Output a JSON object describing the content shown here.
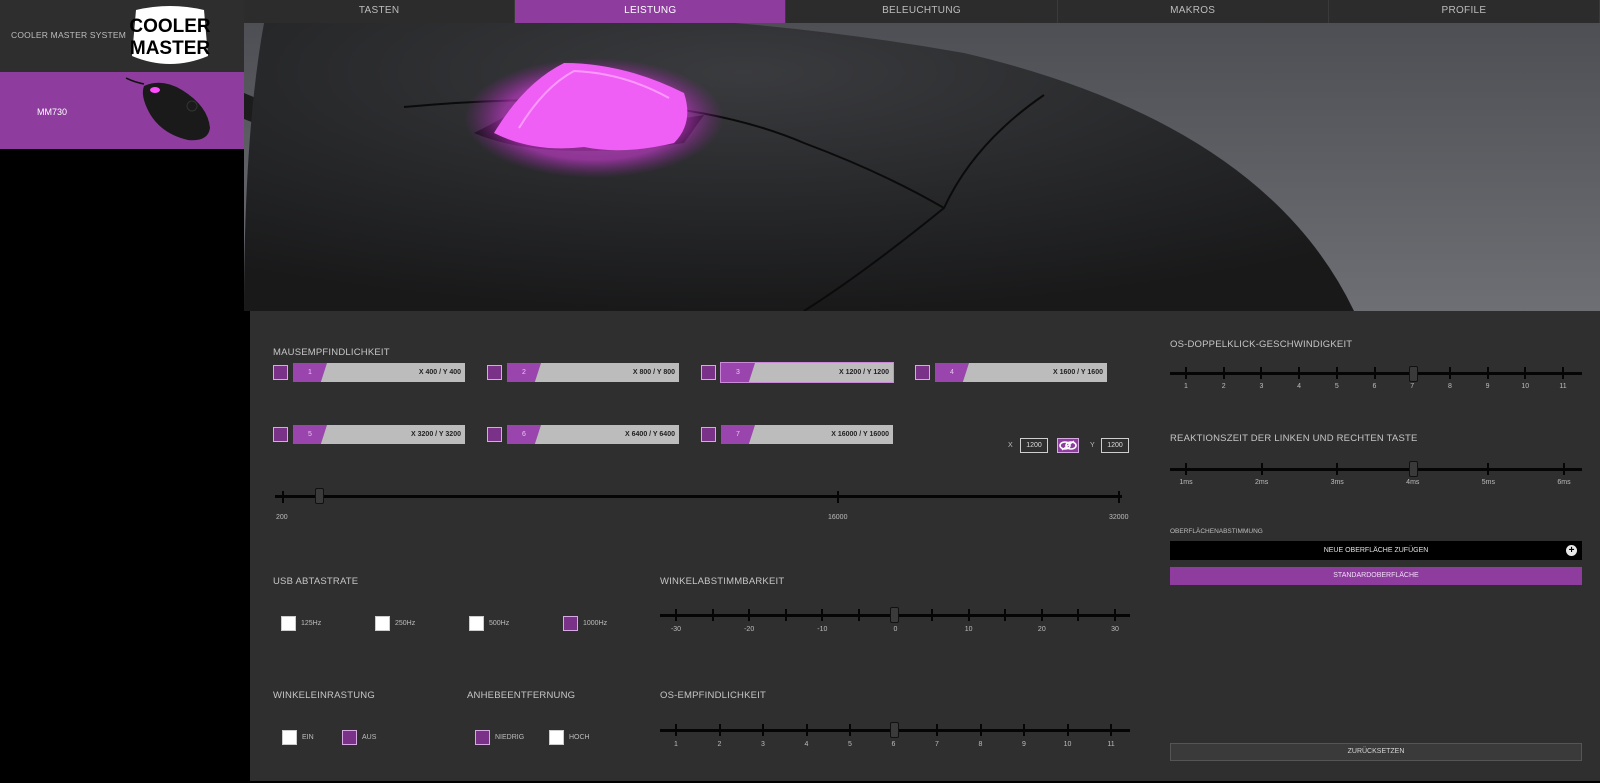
{
  "brand": {
    "system_label": "COOLER MASTER SYSTEM",
    "logo_line1": "COOLER",
    "logo_line2": "MASTER"
  },
  "device": {
    "name": "MM730"
  },
  "tabs": [
    {
      "label": "TASTEN",
      "active": false
    },
    {
      "label": "LEISTUNG",
      "active": true
    },
    {
      "label": "BELEUCHTUNG",
      "active": false
    },
    {
      "label": "MAKROS",
      "active": false
    },
    {
      "label": "PROFILE",
      "active": false
    }
  ],
  "sensitivity": {
    "title": "MAUSEMPFINDLICHKEIT",
    "presets": [
      {
        "num": "1",
        "value": "X 400 / Y 400"
      },
      {
        "num": "2",
        "value": "X 800 / Y 800"
      },
      {
        "num": "3",
        "value": "X 1200 / Y 1200",
        "selected": true
      },
      {
        "num": "4",
        "value": "X 1600 / Y 1600"
      },
      {
        "num": "5",
        "value": "X 3200 / Y 3200"
      },
      {
        "num": "6",
        "value": "X 6400 / Y 6400"
      },
      {
        "num": "7",
        "value": "X 16000 / Y 16000"
      }
    ],
    "x_label": "X",
    "x_value": "1200",
    "y_label": "Y",
    "y_value": "1200",
    "slider": {
      "min_label": "200",
      "mid_label": "16000",
      "max_label": "32000",
      "value": 1200
    }
  },
  "usb_rate": {
    "title": "USB ABTASTRATE",
    "options": [
      {
        "label": "125Hz",
        "checked": false
      },
      {
        "label": "250Hz",
        "checked": false
      },
      {
        "label": "500Hz",
        "checked": false
      },
      {
        "label": "1000Hz",
        "checked": true
      }
    ]
  },
  "angle_tuning": {
    "title": "WINKELABSTIMMBARKEIT",
    "labels": [
      "-30",
      "-20",
      "-10",
      "0",
      "10",
      "20",
      "30"
    ],
    "value": 0
  },
  "angle_snap": {
    "title": "WINKELEINRASTUNG",
    "options": [
      {
        "label": "EIN",
        "checked": false
      },
      {
        "label": "AUS",
        "checked": true
      }
    ]
  },
  "lift_off": {
    "title": "ANHEBEENTFERNUNG",
    "options": [
      {
        "label": "NIEDRIG",
        "checked": true
      },
      {
        "label": "HOCH",
        "checked": false
      }
    ]
  },
  "os_sensitivity": {
    "title": "OS-EMPFINDLICHKEIT",
    "labels": [
      "1",
      "2",
      "3",
      "4",
      "5",
      "6",
      "7",
      "8",
      "9",
      "10",
      "11"
    ],
    "value": 6
  },
  "double_click": {
    "title": "OS-DOPPELKLICK-GESCHWINDIGKEIT",
    "labels": [
      "1",
      "2",
      "3",
      "4",
      "5",
      "6",
      "7",
      "8",
      "9",
      "10",
      "11"
    ],
    "value": 7
  },
  "response_time": {
    "title": "REAKTIONSZEIT DER LINKEN UND RECHTEN TASTE",
    "labels": [
      "1ms",
      "2ms",
      "3ms",
      "4ms",
      "5ms",
      "6ms"
    ],
    "value": "4ms"
  },
  "surface": {
    "title": "OBERFLÄCHENABSTIMMUNG",
    "add_label": "NEUE OBERFLÄCHE ZUFÜGEN",
    "default_label": "STANDARDOBERFLÄCHE"
  },
  "reset_label": "ZURÜCKSETZEN",
  "colors": {
    "accent": "#8e3d9f",
    "panel": "#2f2f2f",
    "glow": "#ff4dff"
  }
}
